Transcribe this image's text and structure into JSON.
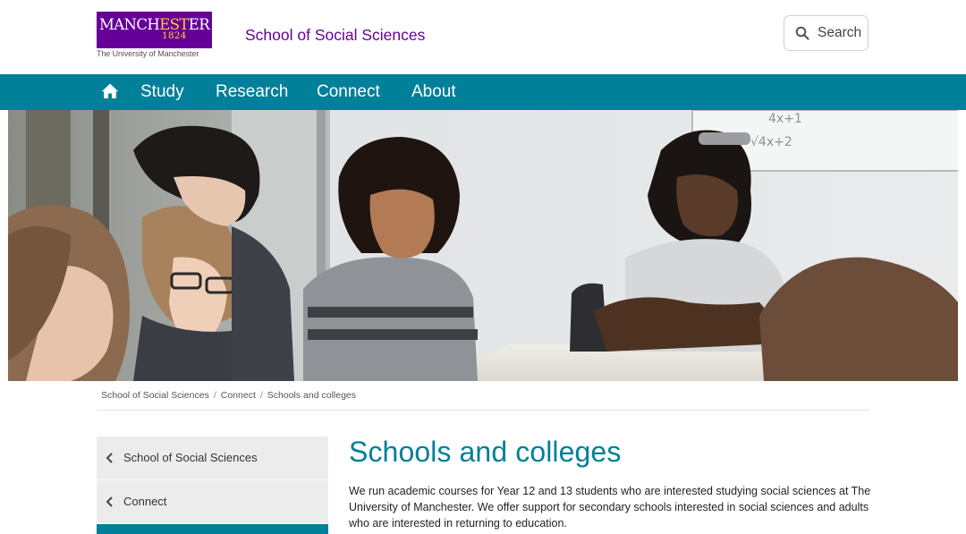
{
  "header": {
    "logo_word_a": "MANCH",
    "logo_word_b": "EST",
    "logo_word_c": "ER",
    "logo_year": "1824",
    "logo_sub": "The University of Manchester",
    "school_title": "School of Social Sciences",
    "search_label": "Search"
  },
  "nav": {
    "home_icon": "home-icon",
    "items": [
      {
        "label": "Study"
      },
      {
        "label": "Research"
      },
      {
        "label": "Connect"
      },
      {
        "label": "About"
      }
    ]
  },
  "breadcrumb": {
    "items": [
      "School of Social Sciences",
      "Connect",
      "Schools and colleges"
    ],
    "separator": "/"
  },
  "sidenav": {
    "items": [
      {
        "label": "School of Social Sciences",
        "icon": "chevron-left-icon"
      },
      {
        "label": "Connect",
        "icon": "chevron-left-icon"
      }
    ]
  },
  "main": {
    "title": "Schools and colleges",
    "intro": "We run academic courses for Year 12 and 13 students who are interested studying social sciences at The University of Manchester. We offer support for secondary schools interested in social sciences and adults who are interested in returning to education."
  },
  "colors": {
    "brand_purple": "#660099",
    "brand_gold": "#ffcc33",
    "accent_teal": "#008099"
  }
}
